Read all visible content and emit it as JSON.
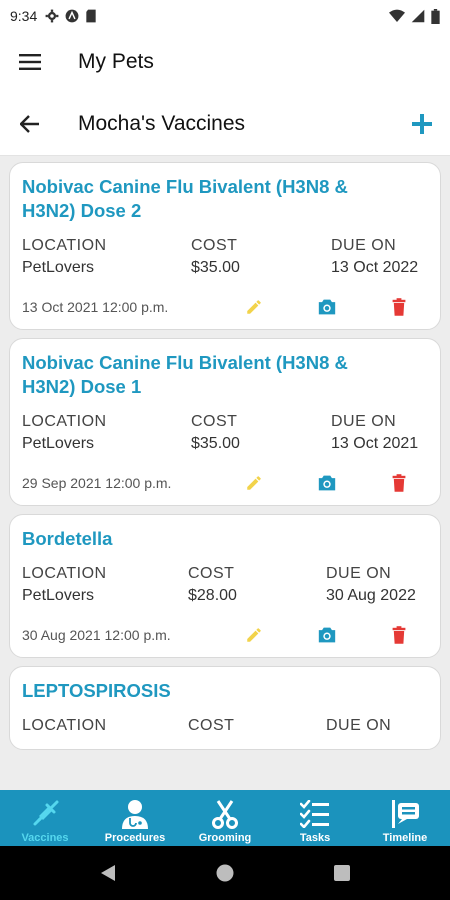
{
  "status_bar": {
    "time": "9:34"
  },
  "app_bar": {
    "title": "My Pets"
  },
  "sub_bar": {
    "title": "Mocha's Vaccines"
  },
  "labels": {
    "location": "LOCATION",
    "cost": "COST",
    "due_on": "DUE ON"
  },
  "vaccines": [
    {
      "name": "Nobivac Canine Flu Bivalent (H3N8 & H3N2) Dose 2",
      "location": "PetLovers",
      "cost": "$35.00",
      "due_on": "13 Oct 2022",
      "date": "13 Oct 2021 12:00 p.m."
    },
    {
      "name": "Nobivac Canine Flu Bivalent (H3N8 & H3N2) Dose 1",
      "location": "PetLovers",
      "cost": "$35.00",
      "due_on": "13 Oct 2021",
      "date": "29 Sep 2021 12:00 p.m."
    },
    {
      "name": "Bordetella",
      "location": "PetLovers",
      "cost": "$28.00",
      "due_on": "30 Aug 2022",
      "date": "30 Aug 2021 12:00 p.m."
    },
    {
      "name": "LEPTOSPIROSIS",
      "location": "",
      "cost": "",
      "due_on": "",
      "date": ""
    }
  ],
  "bottom_nav": {
    "tabs": [
      {
        "label": "Vaccines",
        "icon": "syringe-icon",
        "active": true
      },
      {
        "label": "Procedures",
        "icon": "doctor-icon",
        "active": false
      },
      {
        "label": "Grooming",
        "icon": "scissors-icon",
        "active": false
      },
      {
        "label": "Tasks",
        "icon": "checklist-icon",
        "active": false
      },
      {
        "label": "Timeline",
        "icon": "timeline-icon",
        "active": false
      }
    ]
  },
  "colors": {
    "accent": "#1f98c0",
    "nav_bg": "#1b93bd",
    "nav_active": "#55d7ee",
    "edit": "#f2d34a",
    "delete": "#e53935"
  }
}
